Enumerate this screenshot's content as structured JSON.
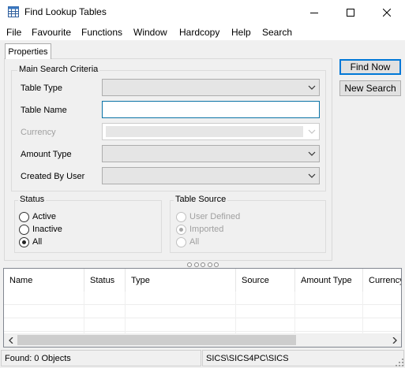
{
  "window": {
    "title": "Find Lookup Tables"
  },
  "menu": [
    "File",
    "Favourite",
    "Functions",
    "Window",
    "Hardcopy",
    "Help",
    "Search"
  ],
  "tabs": [
    {
      "label": "Properties",
      "selected": true
    }
  ],
  "main_search": {
    "title": "Main Search Criteria",
    "fields": {
      "table_type": {
        "label": "Table Type",
        "value": ""
      },
      "table_name": {
        "label": "Table Name",
        "value": ""
      },
      "currency": {
        "label": "Currency",
        "value": "",
        "enabled": false
      },
      "amount_type": {
        "label": "Amount Type",
        "value": ""
      },
      "created_by_user": {
        "label": "Created By User",
        "value": ""
      }
    }
  },
  "status_group": {
    "title": "Status",
    "options": [
      "Active",
      "Inactive",
      "All"
    ],
    "selected": "All"
  },
  "source_group": {
    "title": "Table Source",
    "options": [
      "User Defined",
      "Imported",
      "All"
    ],
    "selected": "Imported",
    "enabled": false
  },
  "buttons": {
    "find_now": "Find Now",
    "new_search": "New Search"
  },
  "results": {
    "columns": [
      "Name",
      "Status",
      "Type",
      "Source",
      "Amount Type",
      "Currency"
    ],
    "rows": []
  },
  "statusbar": {
    "found": "Found: 0 Objects",
    "path": "SICS\\SICS4PC\\SICS"
  },
  "colors": {
    "focus_border": "#0a73a6",
    "default_button": "#0078d7",
    "panel": "#f0f0f0"
  }
}
